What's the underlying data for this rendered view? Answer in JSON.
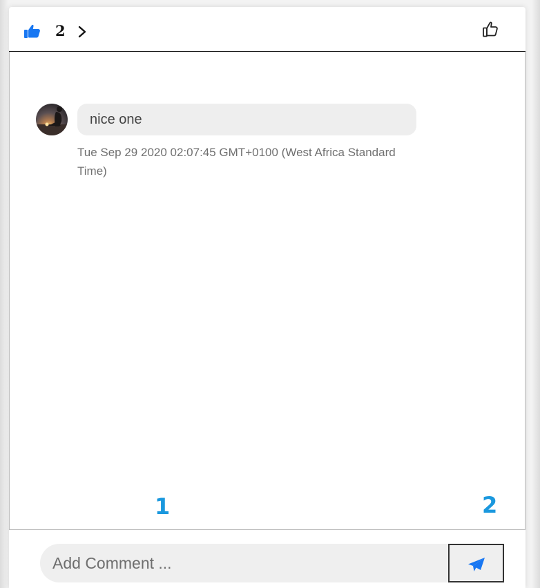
{
  "header": {
    "like_count": "2",
    "icons": {
      "liked": "thumbs-up-filled-icon",
      "expand": "chevron-right-icon",
      "like_action": "thumbs-up-outline-icon"
    },
    "colors": {
      "accent": "#1877f2"
    }
  },
  "comments": [
    {
      "avatar": "avatar",
      "text": "nice one",
      "timestamp": "Tue Sep 29 2020 02:07:45 GMT+0100 (West Africa Standard Time)"
    }
  ],
  "markers": [
    "1",
    "2"
  ],
  "composer": {
    "placeholder": "Add Comment ...",
    "value": "",
    "send_icon": "paper-plane-icon",
    "send_color": "#1877f2"
  }
}
